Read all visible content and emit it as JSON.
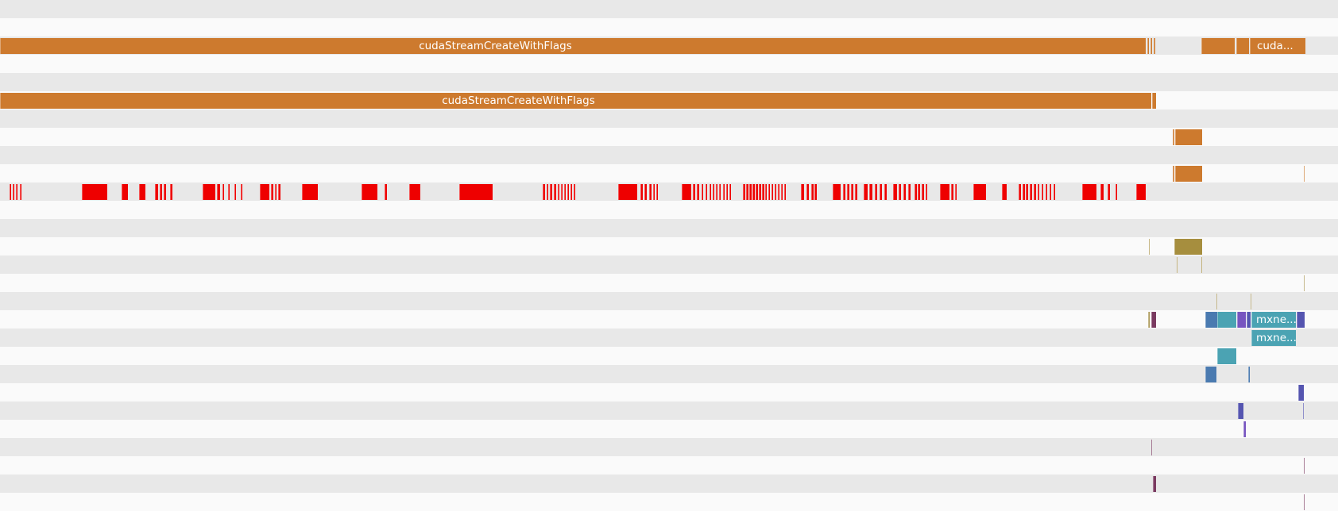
{
  "colors": {
    "row_band_light": "#fafafa",
    "row_band_dark": "#e8e8e8",
    "cuda_api": "#cd7a2e",
    "sync": "#ee0000",
    "memcpy": "#a68e3e",
    "kernel_a": "#4a7ab0",
    "kernel_b": "#4ba3b3",
    "kernel_c": "#5555b0",
    "kernel_d": "#7755c0",
    "kernel_e": "#7a3a60",
    "marker": "#a89450"
  },
  "labels": {
    "api_row_1": "cudaStreamCreateWithFlags",
    "api_row_1_tail": "cuda...",
    "api_row_2": "cudaStreamCreateWithFlags",
    "kernel_row_1": "mxne...",
    "kernel_row_2": "mxne..."
  },
  "rows": 28
}
